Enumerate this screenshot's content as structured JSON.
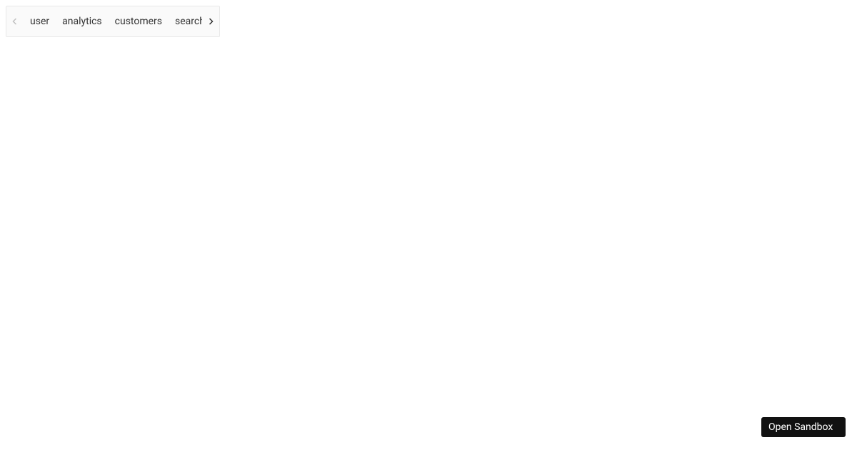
{
  "tabs": {
    "items": [
      {
        "label": "user"
      },
      {
        "label": "analytics"
      },
      {
        "label": "customers"
      },
      {
        "label": "search"
      }
    ]
  },
  "sandbox": {
    "label": "Open Sandbox"
  }
}
